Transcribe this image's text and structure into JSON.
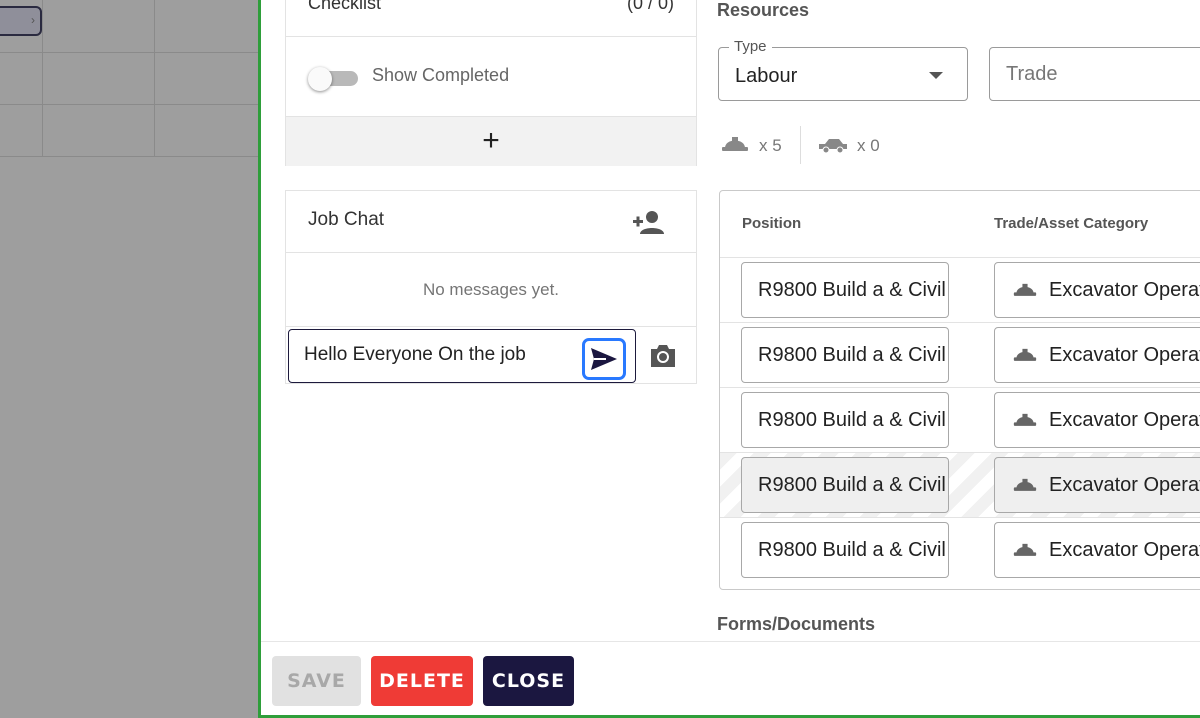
{
  "checklist": {
    "title": "Checklist",
    "count": "(0 / 0)",
    "toggle_label": "Show Completed",
    "add_label": "+"
  },
  "chat": {
    "title": "Job Chat",
    "empty_text": "No messages yet.",
    "input_value": "Hello Everyone On the job"
  },
  "resources": {
    "title": "Resources",
    "type_legend": "Type",
    "type_value": "Labour",
    "trade_placeholder": "Trade",
    "labour_count": "x 5",
    "equipment_count": "x 0",
    "columns": [
      "Position",
      "Trade/Asset Category"
    ],
    "rows": [
      {
        "position": "R9800 Build a & Civil",
        "trade": "Excavator Operator",
        "striped": false
      },
      {
        "position": "R9800 Build a & Civil",
        "trade": "Excavator Operator",
        "striped": false
      },
      {
        "position": "R9800 Build a & Civil",
        "trade": "Excavator Operator",
        "striped": false
      },
      {
        "position": "R9800 Build a & Civil",
        "trade": "Excavator Operator",
        "striped": true
      },
      {
        "position": "R9800 Build a & Civil",
        "trade": "Excavator Operator",
        "striped": false
      }
    ]
  },
  "forms": {
    "title": "Forms/Documents"
  },
  "footer": {
    "save_label": "SAVE",
    "delete_label": "DELETE",
    "close_label": "CLOSE"
  },
  "colors": {
    "accent_green": "#2e9e3a",
    "send_focus": "#2979ff",
    "delete_red": "#ef3b36",
    "close_navy": "#1b1740"
  },
  "icons": [
    "chevron-right-icon",
    "add-person-icon",
    "send-icon",
    "camera-icon",
    "hard-hat-icon",
    "vehicle-icon",
    "dropdown-caret-icon"
  ]
}
